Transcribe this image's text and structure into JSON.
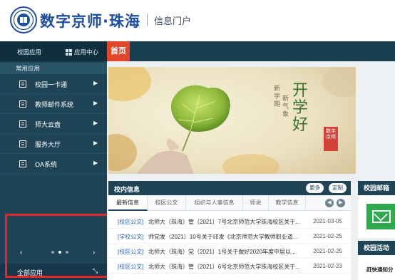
{
  "header": {
    "brand": "数字京师·珠海",
    "portal": "信息门户"
  },
  "topbar": {
    "campus_apps": "校园应用",
    "app_center": "应用中心",
    "home_tab": "首页"
  },
  "sidebar": {
    "section_title": "常用应用",
    "items": [
      {
        "label": "校园一卡通",
        "icon": "card-icon"
      },
      {
        "label": "教师邮件系统",
        "icon": "mail-icon"
      },
      {
        "label": "师大云盘",
        "icon": "cloud-drive-icon"
      },
      {
        "label": "服务大厅",
        "icon": "service-hall-icon"
      },
      {
        "label": "OA系统",
        "icon": "edit-icon"
      }
    ],
    "prev_glyph": "‹",
    "next_glyph": "›",
    "all_apps": "全部应用",
    "expand_glyph": "⤡"
  },
  "banner": {
    "big_text": "开学好",
    "vertical_1": "新学期",
    "vertical_2": "新气象",
    "seal_text": "数字京师"
  },
  "news": {
    "title": "校内信息",
    "more": "更多",
    "customize": "定制",
    "tabs": [
      "最新信息",
      "校区公文",
      "组织与人事信息",
      "师说",
      "教学信息"
    ],
    "rows": [
      {
        "tag": "[校区公文]",
        "title": "北师大（珠海）管（2021）7号北京师范大学珠海校区关于...",
        "date": "2021-03-05"
      },
      {
        "tag": "[学校公文]",
        "title": "师党发（2021）10号关于印发《北京师范大学教师职业道...",
        "date": "2021-02-25"
      },
      {
        "tag": "[校区公文]",
        "title": "北师大（珠海）党（2021）1号关于做好2020年度中层以...",
        "date": "2021-02-25"
      },
      {
        "tag": "[校区公文]",
        "title": "北师大（珠海）管（2021）6号北京师范大学珠海校区关于...",
        "date": "2021-02-23"
      }
    ]
  },
  "right": {
    "mail_title": "校园邮箱",
    "activity_title": "校园活动",
    "activity_note": "赶快通知分"
  },
  "colors": {
    "brand_blue": "#1f4fa0",
    "nav_dark": "#1e4456",
    "home_red": "#e2452a",
    "highlight_red": "#e5262a",
    "mail_green": "#2fa84f"
  }
}
